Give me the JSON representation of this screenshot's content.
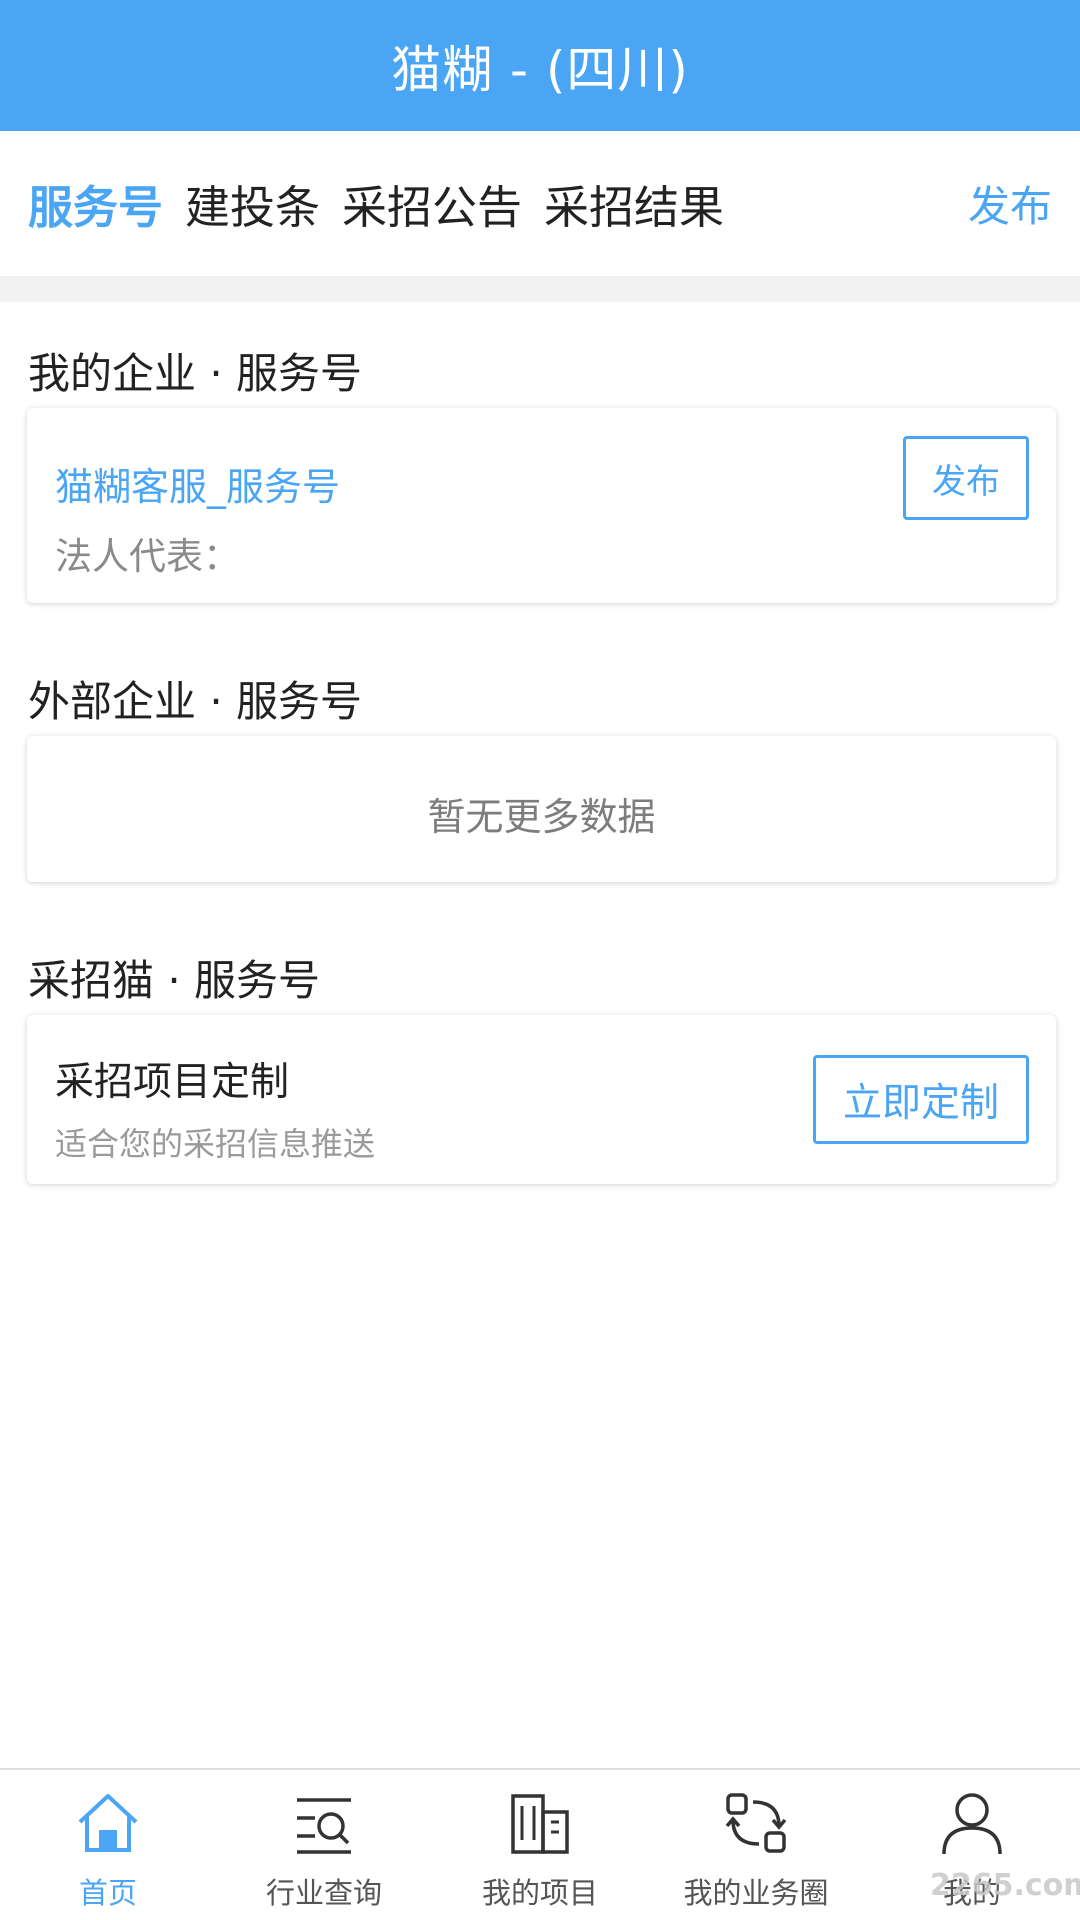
{
  "header": {
    "title": "猫糊 - (四川)"
  },
  "tabs": [
    {
      "label": "服务号"
    },
    {
      "label": "建投条"
    },
    {
      "label": "采招公告"
    },
    {
      "label": "采招结果"
    }
  ],
  "tab_publish": "发布",
  "my_company": {
    "section_title": "我的企业 · 服务号",
    "name": "猫糊客服_服务号",
    "rep_label": "法人代表：",
    "button": "发布"
  },
  "external": {
    "section_title": "外部企业 · 服务号",
    "empty_text": "暂无更多数据"
  },
  "caizhaomao": {
    "section_title": "采招猫 · 服务号",
    "title": "采招项目定制",
    "subtitle": "适合您的采招信息推送",
    "button": "立即定制"
  },
  "bottom_nav": [
    {
      "label": "首页",
      "icon": "home-icon"
    },
    {
      "label": "行业查询",
      "icon": "search-list-icon"
    },
    {
      "label": "我的项目",
      "icon": "building-icon"
    },
    {
      "label": "我的业务圈",
      "icon": "exchange-icon"
    },
    {
      "label": "我的",
      "icon": "user-icon"
    }
  ],
  "watermark": "2265.com",
  "colors": {
    "accent": "#4aa5f5"
  }
}
